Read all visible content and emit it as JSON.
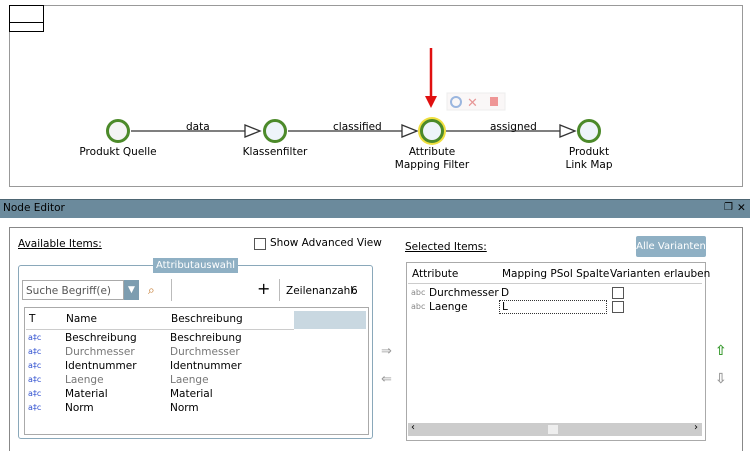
{
  "diagram": {
    "nodes": [
      {
        "label": "Produkt Quelle"
      },
      {
        "label": "Klassenfilter"
      },
      {
        "label": "Attribute Mapping Filter"
      },
      {
        "label": "Produkt Link Map"
      }
    ],
    "edges": [
      {
        "label": "data"
      },
      {
        "label": "classified"
      },
      {
        "label": "assigned"
      }
    ]
  },
  "node_editor": {
    "title": "Node Editor",
    "available_label": "Available Items:",
    "show_advanced": "Show Advanced View",
    "group_label": "Attributauswahl",
    "search_placeholder": "Suche Begriff(e)",
    "add": "+",
    "row_count_label": "Zeilenanzahl:",
    "row_count": "6",
    "available_columns": [
      "T",
      "Name",
      "Beschreibung"
    ],
    "available_rows": [
      {
        "name": "Beschreibung",
        "desc": "Beschreibung",
        "disabled": false
      },
      {
        "name": "Durchmesser",
        "desc": "Durchmesser",
        "disabled": true
      },
      {
        "name": "Identnummer",
        "desc": "Identnummer",
        "disabled": false
      },
      {
        "name": "Laenge",
        "desc": "Laenge",
        "disabled": true
      },
      {
        "name": "Material",
        "desc": "Material",
        "disabled": false
      },
      {
        "name": "Norm",
        "desc": "Norm",
        "disabled": false
      }
    ],
    "selected_label": "Selected Items:",
    "all_variants_button": "Alle Varianten",
    "selected_columns": [
      "Attribute",
      "Mapping PSol Spalte",
      "Varianten erlauben"
    ],
    "selected_rows": [
      {
        "type": "abc",
        "attribute": "Durchmesser",
        "mapping": "D",
        "allow": false
      },
      {
        "type": "abc",
        "attribute": "Laenge",
        "mapping": "L",
        "allow": false
      }
    ],
    "arrows": {
      "right": "⇒",
      "left": "⇐",
      "up": "⇧",
      "down": "⇩"
    }
  }
}
